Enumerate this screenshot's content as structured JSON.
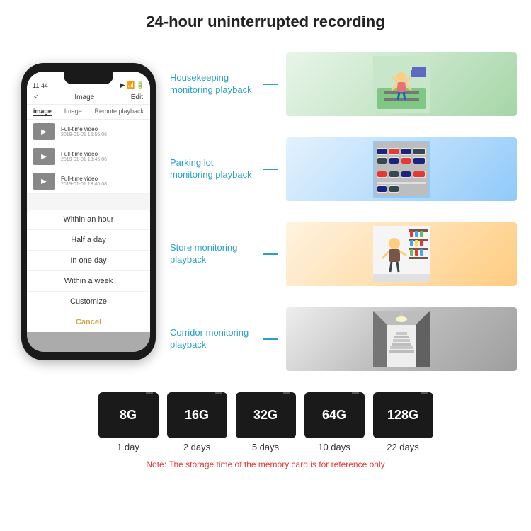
{
  "header": {
    "title": "24-hour uninterrupted recording"
  },
  "phone": {
    "time": "11:44",
    "nav": {
      "back": "<",
      "title": "Image",
      "action": "Edit"
    },
    "tabs": [
      "image",
      "Image",
      "Remote playback"
    ],
    "videos": [
      {
        "label": "Full-time video",
        "date": "2019-01-01 15:55:06"
      },
      {
        "label": "Full-time video",
        "date": "2019-01-01 13:45:06"
      },
      {
        "label": "Full-time video",
        "date": "2019-01-01 13:40:08"
      }
    ],
    "dropdown": {
      "items": [
        "Within an hour",
        "Half a day",
        "In one day",
        "Within a week",
        "Customize"
      ],
      "cancel": "Cancel"
    }
  },
  "monitoring": [
    {
      "label": "Housekeeping monitoring playback",
      "emoji": "👦"
    },
    {
      "label": "Parking lot monitoring playback",
      "emoji": "🚗"
    },
    {
      "label": "Store monitoring playback",
      "emoji": "🏪"
    },
    {
      "label": "Corridor monitoring playback",
      "emoji": "🏢"
    }
  ],
  "sd_cards": [
    {
      "size": "8G",
      "days": "1 day"
    },
    {
      "size": "16G",
      "days": "2 days"
    },
    {
      "size": "32G",
      "days": "5 days"
    },
    {
      "size": "64G",
      "days": "10 days"
    },
    {
      "size": "128G",
      "days": "22 days"
    }
  ],
  "note": "Note: The storage time of the memory card is for reference only"
}
